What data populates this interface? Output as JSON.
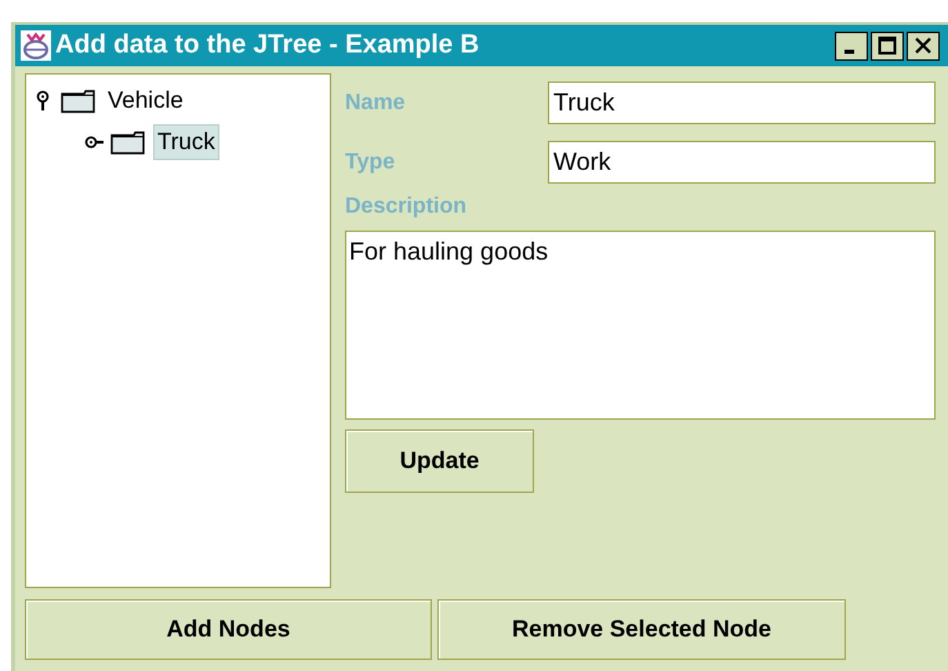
{
  "window": {
    "title": "Add data to the JTree - Example B"
  },
  "tree": [
    {
      "label": "Vehicle",
      "expanded": true,
      "selected": false,
      "children": [
        {
          "label": "Truck",
          "expanded": false,
          "selected": true
        }
      ]
    }
  ],
  "form": {
    "name_label": "Name",
    "name_value": "Truck",
    "type_label": "Type",
    "type_value": "Work",
    "description_label": "Description",
    "description_value": "For hauling goods",
    "update_button": "Update"
  },
  "buttons": [
    "Add Nodes",
    "Remove Selected Node"
  ]
}
